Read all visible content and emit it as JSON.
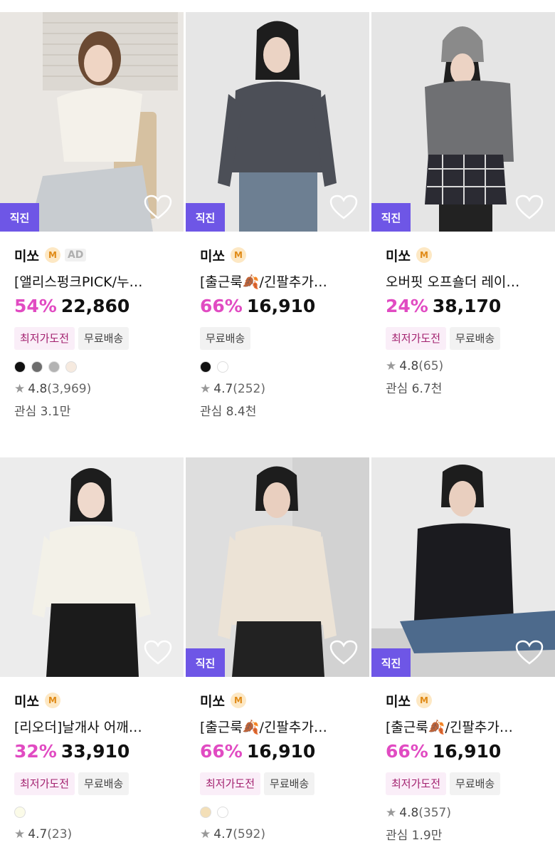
{
  "products": [
    {
      "seller": "미쏘",
      "membership_badge": "M",
      "ad_label": "AD",
      "title": "[앨리스펑크PICK/누…",
      "discount": "54%",
      "price": "22,860",
      "tags": [
        "최저가도전",
        "무료배송"
      ],
      "direct_badge": "직진",
      "swatches": [
        "#111111",
        "#6d6d6d",
        "#b3b3b3",
        "#f6eadf"
      ],
      "rating": "4.8",
      "review_count": "(3,969)",
      "likes": "관심 3.1만"
    },
    {
      "seller": "미쏘",
      "membership_badge": "M",
      "title": "[출근룩🍂/긴팔추가…",
      "discount": "66%",
      "price": "16,910",
      "tags": [
        "무료배송"
      ],
      "direct_badge": "직진",
      "swatches": [
        "#111111",
        "#ffffff"
      ],
      "rating": "4.7",
      "review_count": "(252)",
      "likes": "관심 8.4천"
    },
    {
      "seller": "미쏘",
      "membership_badge": "M",
      "title": "오버핏 오프숄더 레이…",
      "discount": "24%",
      "price": "38,170",
      "tags": [
        "최저가도전",
        "무료배송"
      ],
      "direct_badge": "직진",
      "swatches": [],
      "rating": "4.8",
      "review_count": "(65)",
      "likes": "관심 6.7천"
    },
    {
      "seller": "미쏘",
      "membership_badge": "M",
      "title": "[리오더]날개사 어깨…",
      "discount": "32%",
      "price": "33,910",
      "tags": [
        "최저가도전",
        "무료배송"
      ],
      "swatches": [
        "#fbfbe8"
      ],
      "rating": "4.7",
      "review_count": "(23)",
      "likes": ""
    },
    {
      "seller": "미쏘",
      "membership_badge": "M",
      "title": "[출근룩🍂/긴팔추가…",
      "discount": "66%",
      "price": "16,910",
      "tags": [
        "최저가도전",
        "무료배송"
      ],
      "direct_badge": "직진",
      "swatches": [
        "#f3dfb8",
        "#ffffff"
      ],
      "rating": "4.7",
      "review_count": "(592)",
      "likes": ""
    },
    {
      "seller": "미쏘",
      "membership_badge": "M",
      "title": "[출근룩🍂/긴팔추가…",
      "discount": "66%",
      "price": "16,910",
      "tags": [
        "최저가도전",
        "무료배송"
      ],
      "direct_badge": "직진",
      "swatches": [],
      "rating": "4.8",
      "review_count": "(357)",
      "likes": "관심 1.9만"
    }
  ],
  "icons": {
    "wishlist": "heart-outline-icon",
    "rating": "star-icon"
  },
  "colors": {
    "accent_discount": "#e14bc2",
    "direct_badge_bg": "#6e56e6",
    "lowest_tag_bg": "#faeef8"
  }
}
